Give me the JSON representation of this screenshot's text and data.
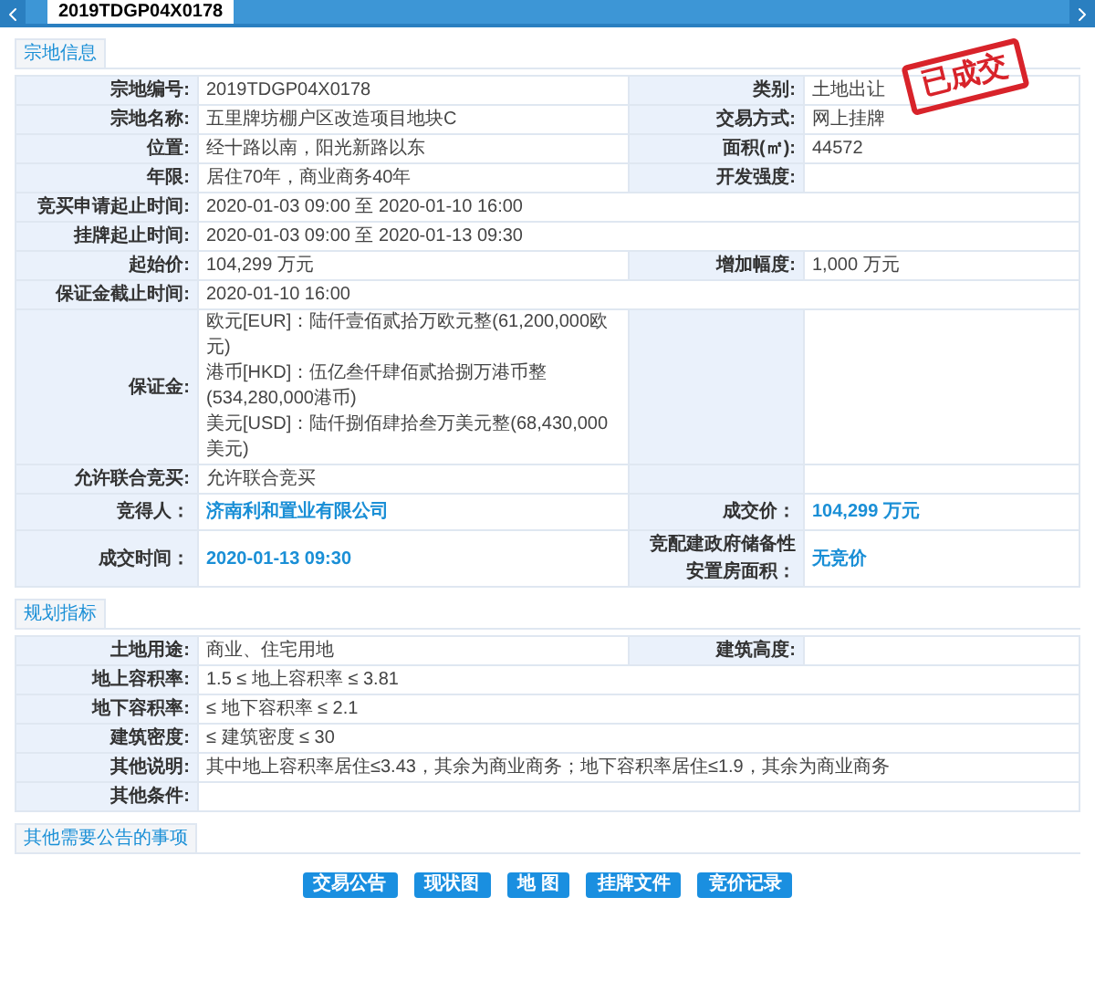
{
  "tab": {
    "label": "2019TDGP04X0178",
    "selected": true
  },
  "stamp": "已成交",
  "sections": [
    {
      "title": "宗地信息",
      "rows": [
        {
          "kind": "pair",
          "cells": [
            {
              "label": "宗地编号:",
              "value": "2019TDGP04X0178"
            },
            {
              "label": "类别:",
              "value": "土地出让"
            }
          ]
        },
        {
          "kind": "pair",
          "cells": [
            {
              "label": "宗地名称:",
              "value": "五里牌坊棚户区改造项目地块C"
            },
            {
              "label": "交易方式:",
              "value": "网上挂牌"
            }
          ]
        },
        {
          "kind": "pair",
          "cells": [
            {
              "label": "位置:",
              "value": "经十路以南，阳光新路以东"
            },
            {
              "label": "面积(㎡):",
              "value": "44572"
            }
          ]
        },
        {
          "kind": "pair",
          "cells": [
            {
              "label": "年限:",
              "value": "居住70年，商业商务40年"
            },
            {
              "label": "开发强度:"
            }
          ]
        },
        {
          "kind": "single",
          "cells": [
            {
              "label": "竞买申请起止时间:",
              "value": "2020-01-03 09:00 至 2020-01-10 16:00"
            }
          ]
        },
        {
          "kind": "single",
          "cells": [
            {
              "label": "挂牌起止时间:",
              "value": "2020-01-03 09:00 至 2020-01-13 09:30"
            }
          ]
        },
        {
          "kind": "pair",
          "cells": [
            {
              "label": "起始价:",
              "value": "104,299 万元"
            },
            {
              "label": "增加幅度:",
              "value": "1,000 万元"
            }
          ]
        },
        {
          "kind": "single",
          "cells": [
            {
              "label": "保证金截止时间:",
              "value": "2020-01-10 16:00"
            }
          ]
        },
        {
          "kind": "lines",
          "cells": [
            {
              "label": "保证金:",
              "lines": [
                "欧元[EUR]：陆仟壹佰贰拾万欧元整(61,200,000欧元)",
                "港币[HKD]：伍亿叁仟肆佰贰拾捌万港币整(534,280,000港币)",
                "美元[USD]：陆仟捌佰肆拾叁万美元整(68,430,000美元)"
              ]
            }
          ]
        },
        {
          "kind": "pair",
          "cells": [
            {
              "label": "允许联合竞买:",
              "value": "允许联合竞买"
            }
          ]
        },
        {
          "kind": "result",
          "cells": [
            {
              "label": "竞得人：",
              "value": "济南利和置业有限公司"
            },
            {
              "label": "成交价：",
              "value": "104,299 万元"
            }
          ]
        },
        {
          "kind": "result",
          "cells": [
            {
              "label": "成交时间：",
              "value": "2020-01-13 09:30"
            },
            {
              "label": "竞配建政府储备性安置房面积：",
              "value": "无竞价"
            }
          ]
        }
      ]
    },
    {
      "title": "规划指标",
      "rows": [
        {
          "kind": "pair",
          "cells": [
            {
              "label": "土地用途:",
              "value": "商业、住宅用地"
            },
            {
              "label": "建筑高度:"
            }
          ]
        },
        {
          "kind": "single",
          "cells": [
            {
              "label": "地上容积率:",
              "value": "1.5 ≤ 地上容积率 ≤ 3.81"
            }
          ]
        },
        {
          "kind": "single",
          "cells": [
            {
              "label": "地下容积率:",
              "value": "≤ 地下容积率 ≤ 2.1"
            }
          ]
        },
        {
          "kind": "single",
          "cells": [
            {
              "label": "建筑密度:",
              "value": "≤ 建筑密度 ≤ 30"
            }
          ]
        },
        {
          "kind": "single",
          "cells": [
            {
              "label": "其他说明:",
              "value": "其中地上容积率居住≤3.43，其余为商业商务；地下容积率居住≤1.9，其余为商业商务"
            }
          ]
        },
        {
          "kind": "single",
          "cells": [
            {
              "label": "其他条件:"
            }
          ]
        }
      ]
    },
    {
      "title": "其他需要公告的事项"
    }
  ],
  "buttons": [
    "交易公告",
    "现状图",
    "地 图",
    "挂牌文件",
    "竞价记录"
  ]
}
